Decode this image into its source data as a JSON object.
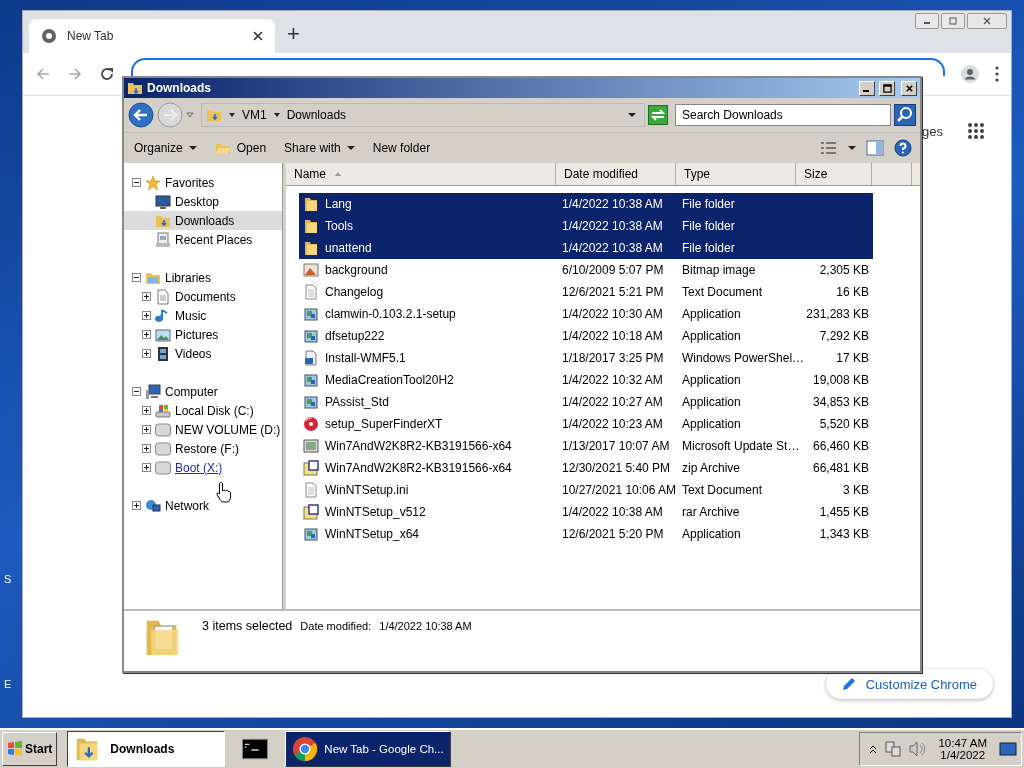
{
  "desktop": {
    "fragments": [
      "S",
      "E"
    ]
  },
  "chrome": {
    "tabs": [
      {
        "label": "New Tab",
        "selected": true
      }
    ],
    "new_tab": "+",
    "content_fragment": "ges",
    "customize": "Customize Chrome"
  },
  "explorer": {
    "title": "Downloads",
    "breadcrumb": [
      "VM1",
      "Downloads"
    ],
    "search": {
      "placeholder": "Search Downloads"
    },
    "toolbar": [
      {
        "label": "Organize",
        "kind": "menu"
      },
      {
        "label": "Open",
        "kind": "open"
      },
      {
        "label": "Share with",
        "kind": "menu"
      },
      {
        "label": "New folder",
        "kind": "plain"
      }
    ],
    "nav": [
      {
        "label": "Favorites",
        "kind": "star",
        "expanded": true,
        "selected": false,
        "children": [
          {
            "label": "Desktop",
            "kind": "desktop",
            "selected": false
          },
          {
            "label": "Downloads",
            "kind": "downloads",
            "selected": true
          },
          {
            "label": "Recent Places",
            "kind": "recent",
            "selected": false
          }
        ]
      },
      {
        "label": "Libraries",
        "kind": "library",
        "expanded": true,
        "selected": false,
        "children": [
          {
            "label": "Documents",
            "kind": "document",
            "expanded": false,
            "selected": false
          },
          {
            "label": "Music",
            "kind": "music",
            "expanded": false,
            "selected": false
          },
          {
            "label": "Pictures",
            "kind": "pictures",
            "expanded": false,
            "selected": false
          },
          {
            "label": "Videos",
            "kind": "video",
            "expanded": false,
            "selected": false
          }
        ]
      },
      {
        "label": "Computer",
        "kind": "computer",
        "expanded": true,
        "selected": false,
        "children": [
          {
            "label": "Local Disk (C:)",
            "kind": "system-drive",
            "expanded": false,
            "selected": false,
            "hovered": false
          },
          {
            "label": "NEW VOLUME (D:)",
            "kind": "drive",
            "expanded": false,
            "selected": false,
            "hovered": false
          },
          {
            "label": "Restore (F:)",
            "kind": "drive",
            "expanded": false,
            "selected": false,
            "hovered": false
          },
          {
            "label": "Boot (X:)",
            "kind": "drive",
            "expanded": false,
            "selected": false,
            "hovered": true
          }
        ]
      },
      {
        "label": "Network",
        "kind": "network",
        "expanded": false,
        "selected": false
      }
    ],
    "columns": [
      {
        "label": "Name",
        "sorted": true
      },
      {
        "label": "Date modified",
        "sorted": false
      },
      {
        "label": "Type",
        "sorted": false
      },
      {
        "label": "Size",
        "sorted": false
      }
    ],
    "rows": [
      {
        "name": "Lang",
        "date": "1/4/2022 10:38 AM",
        "type": "File folder",
        "size": "",
        "kind": "folder",
        "selected": true
      },
      {
        "name": "Tools",
        "date": "1/4/2022 10:38 AM",
        "type": "File folder",
        "size": "",
        "kind": "folder",
        "selected": true
      },
      {
        "name": "unattend",
        "date": "1/4/2022 10:38 AM",
        "type": "File folder",
        "size": "",
        "kind": "folder",
        "selected": true
      },
      {
        "name": "background",
        "date": "6/10/2009 5:07 PM",
        "type": "Bitmap image",
        "size": "2,305 KB",
        "kind": "image",
        "selected": false
      },
      {
        "name": "Changelog",
        "date": "12/6/2021 5:21 PM",
        "type": "Text Document",
        "size": "16 KB",
        "kind": "text",
        "selected": false
      },
      {
        "name": "clamwin-0.103.2.1-setup",
        "date": "1/4/2022 10:30 AM",
        "type": "Application",
        "size": "231,283 KB",
        "kind": "app",
        "selected": false
      },
      {
        "name": "dfsetup222",
        "date": "1/4/2022 10:18 AM",
        "type": "Application",
        "size": "7,292 KB",
        "kind": "app",
        "selected": false
      },
      {
        "name": "Install-WMF5.1",
        "date": "1/18/2017 3:25 PM",
        "type": "Windows PowerShel…",
        "size": "17 KB",
        "kind": "script",
        "selected": false
      },
      {
        "name": "MediaCreationTool20H2",
        "date": "1/4/2022 10:32 AM",
        "type": "Application",
        "size": "19,008 KB",
        "kind": "app",
        "selected": false
      },
      {
        "name": "PAssist_Std",
        "date": "1/4/2022 10:27 AM",
        "type": "Application",
        "size": "34,853 KB",
        "kind": "app",
        "selected": false
      },
      {
        "name": "setup_SuperFinderXT",
        "date": "1/4/2022 10:23 AM",
        "type": "Application",
        "size": "5,520 KB",
        "kind": "disc",
        "selected": false
      },
      {
        "name": "Win7AndW2K8R2-KB3191566-x64",
        "date": "1/13/2017 10:07 AM",
        "type": "Microsoft Update St…",
        "size": "66,460 KB",
        "kind": "package",
        "selected": false
      },
      {
        "name": "Win7AndW2K8R2-KB3191566-x64",
        "date": "12/30/2021 5:40 PM",
        "type": "zip Archive",
        "size": "66,481 KB",
        "kind": "archive",
        "selected": false
      },
      {
        "name": "WinNTSetup.ini",
        "date": "10/27/2021 10:06 AM",
        "type": "Text Document",
        "size": "3 KB",
        "kind": "text",
        "selected": false
      },
      {
        "name": "WinNTSetup_v512",
        "date": "1/4/2022 10:38 AM",
        "type": "rar Archive",
        "size": "1,455 KB",
        "kind": "archive",
        "selected": false
      },
      {
        "name": "WinNTSetup_x64",
        "date": "12/6/2021 5:20 PM",
        "type": "Application",
        "size": "1,343 KB",
        "kind": "app",
        "selected": false
      }
    ],
    "status": {
      "count": "3 items selected",
      "date_label": "Date modified:",
      "date": "1/4/2022 10:38 AM"
    }
  },
  "taskbar": {
    "start": "Start",
    "tasks": [
      {
        "label": "Downloads",
        "kind": "folder",
        "selected": true
      },
      {
        "kind": "console",
        "selected": false
      },
      {
        "label": "New Tab - Google Ch...",
        "kind": "browser",
        "selected": false
      }
    ],
    "time": "10:47 AM",
    "date": "1/4/2022"
  }
}
